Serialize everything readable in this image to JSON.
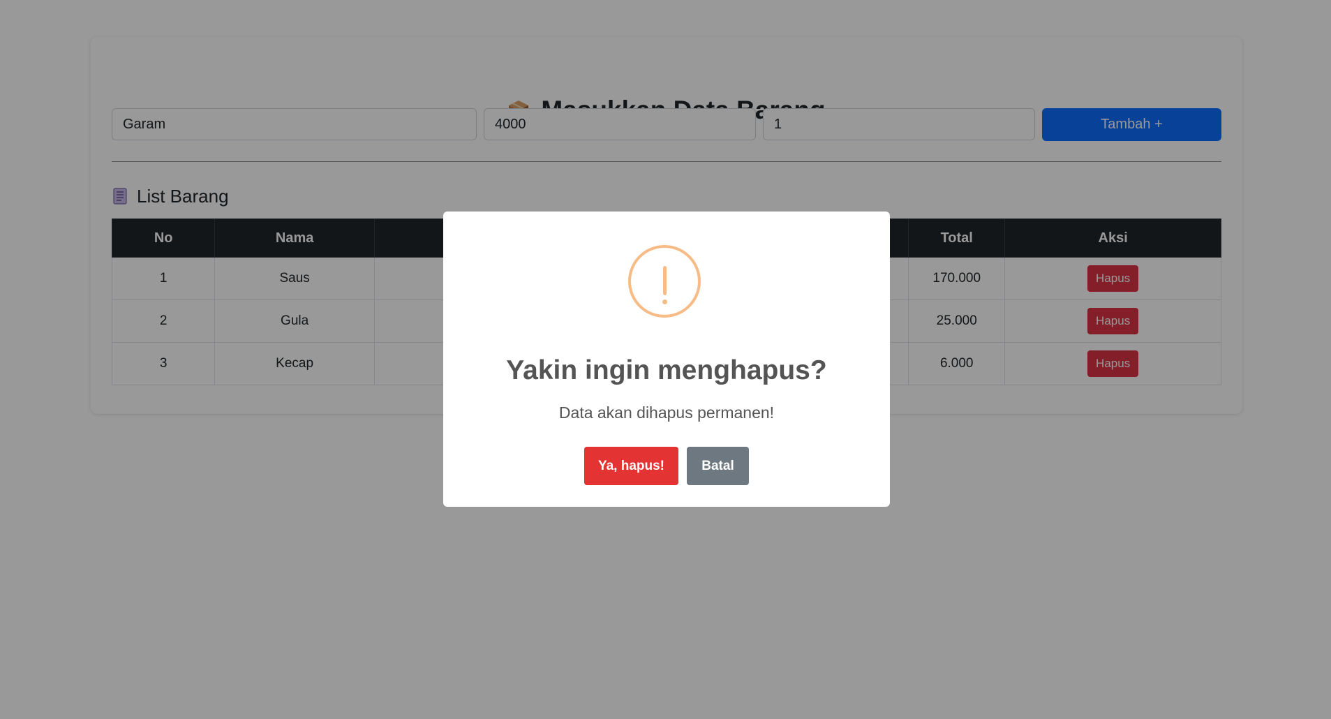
{
  "form": {
    "title": "Masukkan Data Barang",
    "title_icon": "package-icon",
    "nama_value": "Garam",
    "harga_value": "4000",
    "jumlah_value": "1",
    "add_label": "Tambah +"
  },
  "list": {
    "title": "List Barang",
    "title_icon": "ledger-icon",
    "headers": {
      "no": "No",
      "nama": "Nama",
      "total": "Total",
      "aksi": "Aksi"
    },
    "rows": [
      {
        "no": "1",
        "nama": "Saus",
        "total": "170.000",
        "aksi": "Hapus"
      },
      {
        "no": "2",
        "nama": "Gula",
        "total": "25.000",
        "aksi": "Hapus"
      },
      {
        "no": "3",
        "nama": "Kecap",
        "total": "6.000",
        "aksi": "Hapus"
      }
    ]
  },
  "modal": {
    "icon": "warning-icon",
    "title": "Yakin ingin menghapus?",
    "text": "Data akan dihapus permanen!",
    "confirm_label": "Ya, hapus!",
    "cancel_label": "Batal"
  },
  "colors": {
    "primary": "#0d6efd",
    "danger": "#dc3545",
    "confirm": "#e33333",
    "cancel": "#6e7881",
    "warning": "#f8bb86",
    "table_header": "#212529"
  }
}
